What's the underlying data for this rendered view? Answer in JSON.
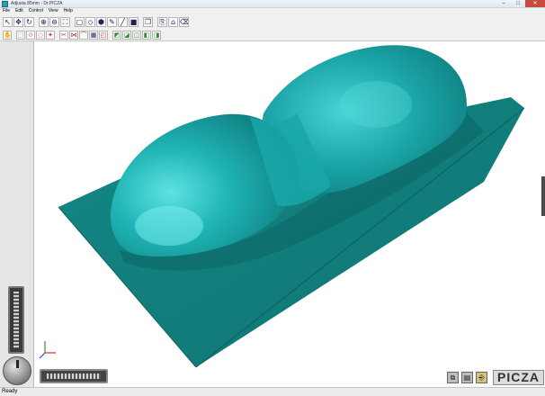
{
  "window": {
    "title": "Adjusta 85mm - Dr.PICZA",
    "controls": [
      "–",
      "□",
      "✕"
    ]
  },
  "menu": [
    "File",
    "Edit",
    "Control",
    "View",
    "Help"
  ],
  "toolbar1": [
    {
      "name": "pointer-tool",
      "glyph": "↖"
    },
    {
      "name": "move-tool",
      "glyph": "✥"
    },
    {
      "name": "rotate-tool",
      "glyph": "↻"
    },
    {
      "sep": true
    },
    {
      "name": "zoom-in-tool",
      "glyph": "⊕"
    },
    {
      "name": "zoom-out-tool",
      "glyph": "⊖"
    },
    {
      "name": "zoom-fit-tool",
      "glyph": "⛶"
    },
    {
      "sep": true
    },
    {
      "name": "box-tool",
      "glyph": "▢"
    },
    {
      "name": "wireframe-tool",
      "glyph": "◇"
    },
    {
      "name": "shade-tool",
      "glyph": "⬢"
    },
    {
      "name": "paint-tool",
      "glyph": "✎"
    },
    {
      "name": "brush-tool",
      "glyph": "╱"
    },
    {
      "name": "surface-tool",
      "glyph": "■"
    },
    {
      "sep": true
    },
    {
      "name": "layer-tool",
      "glyph": "❐"
    },
    {
      "sep": true
    },
    {
      "name": "copy-tool",
      "glyph": "⎘"
    },
    {
      "name": "stamp-tool",
      "glyph": "⌂"
    },
    {
      "name": "eraser-tool",
      "glyph": "⌫"
    }
  ],
  "toolbar2": [
    {
      "name": "hand-tool",
      "glyph": "✋"
    },
    {
      "sep": true
    },
    {
      "name": "select-rect-tool",
      "glyph": "⬚",
      "color": "red"
    },
    {
      "name": "select-poly-tool",
      "glyph": "⟐",
      "color": "red"
    },
    {
      "name": "select-lasso-tool",
      "glyph": "◌",
      "color": "red"
    },
    {
      "name": "select-magic-tool",
      "glyph": "✦",
      "color": "red"
    },
    {
      "sep": true
    },
    {
      "name": "cut-tool",
      "glyph": "✂",
      "color": "red"
    },
    {
      "name": "mirror-tool",
      "glyph": "⋈",
      "color": "red"
    },
    {
      "name": "arc-tool",
      "glyph": "⌒",
      "color": "red"
    },
    {
      "name": "grid-tool",
      "glyph": "▦"
    },
    {
      "name": "frame-tool",
      "glyph": "◰",
      "color": "red"
    },
    {
      "sep": true
    },
    {
      "name": "view-front-tool",
      "glyph": "◩",
      "color": "gr"
    },
    {
      "name": "view-top-tool",
      "glyph": "◪",
      "color": "gr"
    },
    {
      "name": "view-side-tool",
      "glyph": "◫",
      "color": "gr"
    },
    {
      "name": "view-iso-tool",
      "glyph": "◧",
      "color": "gr"
    },
    {
      "name": "view-back-tool",
      "glyph": "◨",
      "color": "gr"
    }
  ],
  "colors": {
    "model_base": "#127f7c",
    "model_body": "#1aa8a9",
    "model_highlight": "#5fe2e2"
  },
  "bottom_icons": [
    "⧉",
    "▤",
    "⎆"
  ],
  "logo": "PICZA",
  "status": "Ready"
}
